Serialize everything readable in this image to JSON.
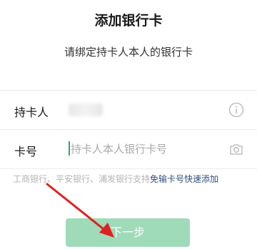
{
  "header": {
    "title": "添加银行卡",
    "subtitle": "请绑定持卡人本人的银行卡"
  },
  "form": {
    "holder": {
      "label": "持卡人",
      "icon": "info-icon"
    },
    "card_number": {
      "label": "卡号",
      "placeholder": "持卡人本人银行卡号",
      "value": "",
      "icon": "camera-icon"
    }
  },
  "hint": {
    "text": "工商银行、平安银行、浦发银行支持",
    "link": "免输卡号快速添加"
  },
  "next_button": {
    "label": "下一步"
  },
  "colors": {
    "accent": "#2aae67",
    "button_disabled": "#9fdbb8",
    "link": "#2e4f7c",
    "annotation_arrow": "#e02020"
  }
}
